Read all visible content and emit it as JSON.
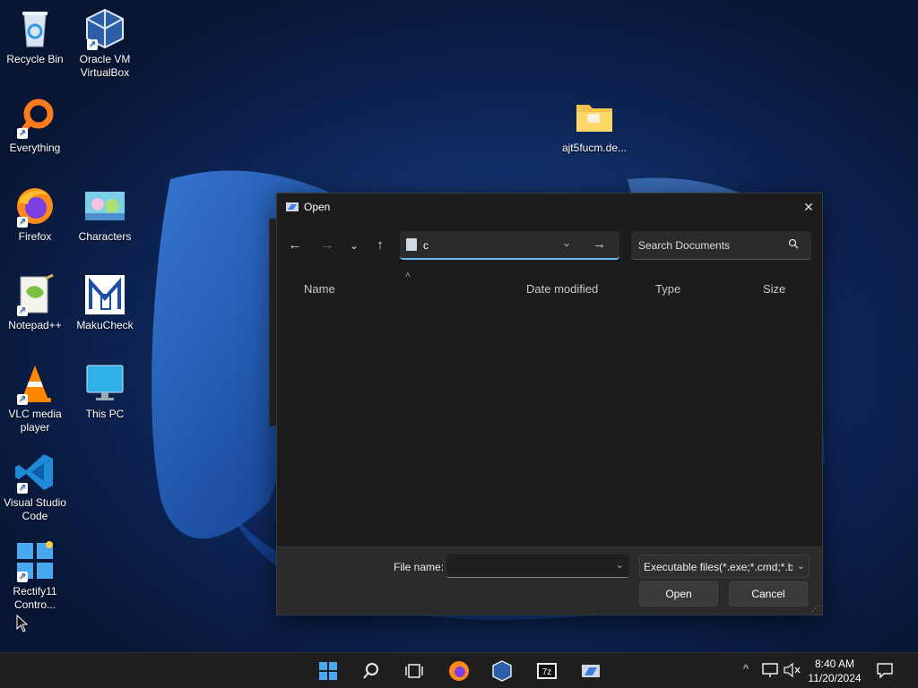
{
  "desktop": {
    "icons": [
      {
        "label": "Recycle Bin",
        "icon": "recycle-bin-icon"
      },
      {
        "label": "Oracle VM VirtualBox",
        "icon": "virtualbox-icon"
      },
      {
        "label": "Everything",
        "icon": "everything-search-icon"
      },
      {
        "label": "Firefox",
        "icon": "firefox-icon"
      },
      {
        "label": "Characters",
        "icon": "characters-icon"
      },
      {
        "label": "Notepad++",
        "icon": "notepad-plus-plus-icon"
      },
      {
        "label": "MakuCheck",
        "icon": "makucheck-icon"
      },
      {
        "label": "VLC media player",
        "icon": "vlc-icon"
      },
      {
        "label": "This PC",
        "icon": "this-pc-icon"
      },
      {
        "label": "Visual Studio Code",
        "icon": "vscode-icon"
      },
      {
        "label": "Rectify11 Contro...",
        "icon": "rectify11-icon"
      },
      {
        "label": "ajt5fucm.de...",
        "icon": "folder-icon"
      }
    ]
  },
  "dialog": {
    "title": "Open",
    "close_glyph": "✕",
    "nav": {
      "back": "←",
      "forward": "→",
      "recent": "⌄",
      "up": "↑"
    },
    "address": {
      "value": "c",
      "dropdown": "⌄",
      "go": "→"
    },
    "search": {
      "placeholder": "Search Documents"
    },
    "columns": {
      "sort_indicator": "˄",
      "name": "Name",
      "date_modified": "Date modified",
      "type": "Type",
      "size": "Size"
    },
    "footer": {
      "file_name_label": "File name:",
      "file_name_value": "",
      "file_type_value": "Executable files(*.exe;*.cmd;*.bat",
      "open_label": "Open",
      "cancel_label": "Cancel"
    }
  },
  "taskbar": {
    "clock_time": "8:40 AM",
    "clock_date": "11/20/2024",
    "chevron": "^"
  },
  "colors": {
    "accent": "#6cb8ff",
    "dialog_bg": "#1c1c1c",
    "taskbar_bg": "#1f1f1f"
  }
}
